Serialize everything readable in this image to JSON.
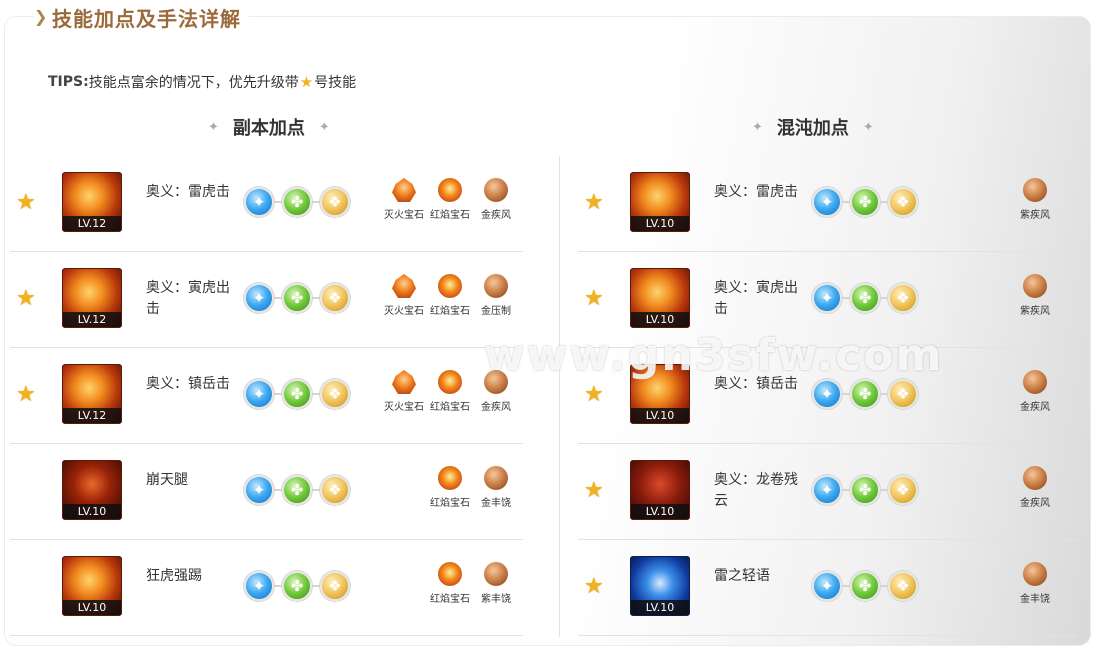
{
  "page": {
    "heading": "技能加点及手法详解",
    "tips_prefix": "TIPS:",
    "tips_text_a": "技能点富余的情况下，优先升级带",
    "tips_text_b": "号技能",
    "watermark": "www.gn3sfw.com"
  },
  "columns": {
    "left_title": "副本加点",
    "right_title": "混沌加点"
  },
  "left_rows": [
    {
      "starred": true,
      "level": "LV.12",
      "name": "奥义：雷虎击",
      "gems": [
        "灭火宝石",
        "红焰宝石",
        "金疾风"
      ]
    },
    {
      "starred": true,
      "level": "LV.12",
      "name": "奥义：寅虎出击",
      "gems": [
        "灭火宝石",
        "红焰宝石",
        "金压制"
      ]
    },
    {
      "starred": true,
      "level": "LV.12",
      "name": "奥义：镇岳击",
      "gems": [
        "灭火宝石",
        "红焰宝石",
        "金疾风"
      ]
    },
    {
      "starred": false,
      "level": "LV.10",
      "name": "崩天腿",
      "gems": [
        "红焰宝石",
        "金丰饶"
      ]
    },
    {
      "starred": false,
      "level": "LV.10",
      "name": "狂虎强踢",
      "gems": [
        "红焰宝石",
        "紫丰饶"
      ]
    }
  ],
  "right_rows": [
    {
      "starred": true,
      "level": "LV.10",
      "name": "奥义：雷虎击",
      "gems": [
        "紫疾风"
      ]
    },
    {
      "starred": true,
      "level": "LV.10",
      "name": "奥义：寅虎出击",
      "gems": [
        "紫疾风"
      ]
    },
    {
      "starred": true,
      "level": "LV.10",
      "name": "奥义：镇岳击",
      "gems": [
        "金疾风"
      ]
    },
    {
      "starred": true,
      "level": "LV.10",
      "name": "奥义：龙卷残云",
      "gems": [
        "金疾风"
      ]
    },
    {
      "starred": true,
      "level": "LV.10",
      "name": "雷之轻语",
      "gems": [
        "金丰饶"
      ]
    }
  ],
  "icons": {
    "star": "star-icon",
    "heading": "diamond-arrow-icon",
    "ornament": "sparkle-icon"
  },
  "colors": {
    "heading": "#9b6a3a",
    "star": "#f3b11a"
  }
}
